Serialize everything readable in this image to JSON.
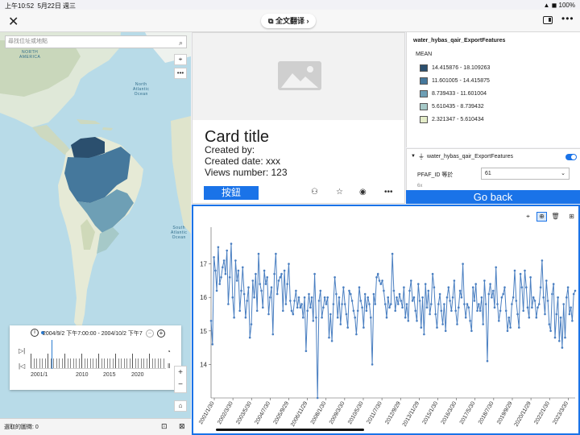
{
  "status": {
    "time": "上午10:52",
    "date": "5月22日 週三",
    "battery": "100%"
  },
  "topbar": {
    "close_glyph": "✕",
    "translate_label": "全文翻译 ›",
    "more_glyph": "•••"
  },
  "map": {
    "search_placeholder": "尋找位址或地點",
    "labels": {
      "north_america": "NORTH\nAMERICA",
      "north_atlantic": "North\nAtlantic\nOcean",
      "south_atlantic": "South\nAtlantic\nOcean"
    },
    "time_slider": {
      "range": "2004/9/2 下午7:00:00 - 2004/10/2 下午7",
      "years": [
        "2001/1",
        "2010",
        "2015",
        "2020"
      ]
    },
    "bottom": {
      "selected_count": "選取的圖徵: 0"
    }
  },
  "card": {
    "title": "Card title",
    "created_by": "Created by:",
    "created_date": "Created date: xxx",
    "views": "Views number: 123",
    "button_label": "按鈕"
  },
  "legend": {
    "layer_title": "water_hybas_qair_ExportFeatures",
    "field": "MEAN",
    "classes": [
      {
        "label": "14.415876 - 18.109263",
        "color": "#2b4f6e"
      },
      {
        "label": "11.601005 - 14.415875",
        "color": "#45789c"
      },
      {
        "label": "8.739433 - 11.601004",
        "color": "#6e9fb5"
      },
      {
        "label": "5.610435 - 8.739432",
        "color": "#a6c9c8"
      },
      {
        "label": "2.321347 - 5.610434",
        "color": "#e4ecc8"
      }
    ]
  },
  "filter": {
    "layer_name": "water_hybas_qair_ExportFeatures",
    "field_label": "PFAF_ID 等於",
    "value": "61",
    "count_hint": "6x"
  },
  "go_back_label": "Go back",
  "chart_data": {
    "type": "line",
    "series_color": "#4a7fc1",
    "ylim": [
      13.0,
      18.0
    ],
    "yticks": [
      14,
      15,
      16,
      17
    ],
    "xticks": [
      "2001/1/30",
      "2002/3/30",
      "2003/5/30",
      "2004/7/30",
      "2005/9/29",
      "2006/11/29",
      "2008/1/30",
      "2009/3/30",
      "2010/5/30",
      "2011/7/30",
      "2012/9/29",
      "2013/11/29",
      "2015/1/30",
      "2016/3/30",
      "2017/5/30",
      "2018/7/30",
      "2019/9/29",
      "2020/11/29",
      "2022/1/30",
      "2023/3/30"
    ],
    "x_start": "2001/1/30",
    "x_end": "2023/12/30",
    "values": [
      15.3,
      14.6,
      17.2,
      16.8,
      16.2,
      17.5,
      16.4,
      16.6,
      16.9,
      17.1,
      16.7,
      17.4,
      15.8,
      16.6,
      17.6,
      16.0,
      15.4,
      17.1,
      16.5,
      16.8,
      15.6,
      16.2,
      16.9,
      16.1,
      15.4,
      15.9,
      16.3,
      14.8,
      15.2,
      16.5,
      16.0,
      16.7,
      15.6,
      17.3,
      16.4,
      16.2,
      15.7,
      16.8,
      16.4,
      16.6,
      15.5,
      16.0,
      16.3,
      14.9,
      16.7,
      17.3,
      16.1,
      16.5,
      16.6,
      16.7,
      15.6,
      16.8,
      15.8,
      16.4,
      17.0,
      15.9,
      15.6,
      15.5,
      15.9,
      16.2,
      15.7,
      16.0,
      15.7,
      15.8,
      15.4,
      16.0,
      14.4,
      15.6,
      16.1,
      15.7,
      16.0,
      15.3,
      16.7,
      15.4,
      13.0,
      15.9,
      16.2,
      15.4,
      15.7,
      16.0,
      15.8,
      16.0,
      14.8,
      15.5,
      14.7,
      15.8,
      16.6,
      16.1,
      15.4,
      16.0,
      15.2,
      15.8,
      16.3,
      15.8,
      15.5,
      15.1,
      16.2,
      16.1,
      15.9,
      15.6,
      15.4,
      14.9,
      15.6,
      16.3,
      15.9,
      15.7,
      15.1,
      16.1,
      15.6,
      16.0,
      15.8,
      15.4,
      14.0,
      16.1,
      15.8,
      16.6,
      16.7,
      16.5,
      16.4,
      16.5,
      16.2,
      15.8,
      15.4,
      16.0,
      15.7,
      15.8,
      17.3,
      16.2,
      15.6,
      16.0,
      15.8,
      16.1,
      15.9,
      15.7,
      16.3,
      15.4,
      15.8,
      15.3,
      16.2,
      16.5,
      15.9,
      16.0,
      15.6,
      15.3,
      16.4,
      15.9,
      15.1,
      16.0,
      14.9,
      16.4,
      15.7,
      16.2,
      15.5,
      15.8,
      16.7,
      16.3,
      15.5,
      15.1,
      15.8,
      16.1,
      15.6,
      15.2,
      15.8,
      15.0,
      16.0,
      16.3,
      15.9,
      15.6,
      16.0,
      16.5,
      15.6,
      15.2,
      15.7,
      16.2,
      16.0,
      17.0,
      15.8,
      15.4,
      15.8,
      15.7,
      15.3,
      15.0,
      16.3,
      15.9,
      16.4,
      15.6,
      15.8,
      15.6,
      16.0,
      15.2,
      16.5,
      15.8,
      14.1,
      16.1,
      16.4,
      16.0,
      16.2,
      15.7,
      16.9,
      15.8,
      15.3,
      15.6,
      16.0,
      16.1,
      16.3,
      15.6,
      15.0,
      15.4,
      15.1,
      15.8,
      16.0,
      16.8,
      15.9,
      15.5,
      15.1,
      16.7,
      16.3,
      15.6,
      16.8,
      16.3,
      15.7,
      15.4,
      16.6,
      15.7,
      16.0,
      15.9,
      15.4,
      15.7,
      15.8,
      16.3,
      17.1,
      16.0,
      15.5,
      16.5,
      15.9,
      15.2,
      15.0,
      16.1,
      16.4,
      14.8,
      15.5,
      16.0,
      14.7,
      15.4,
      14.5,
      15.8,
      14.8,
      16.0,
      16.3,
      15.5,
      15.7,
      15.3,
      16.1,
      16.2
    ]
  }
}
